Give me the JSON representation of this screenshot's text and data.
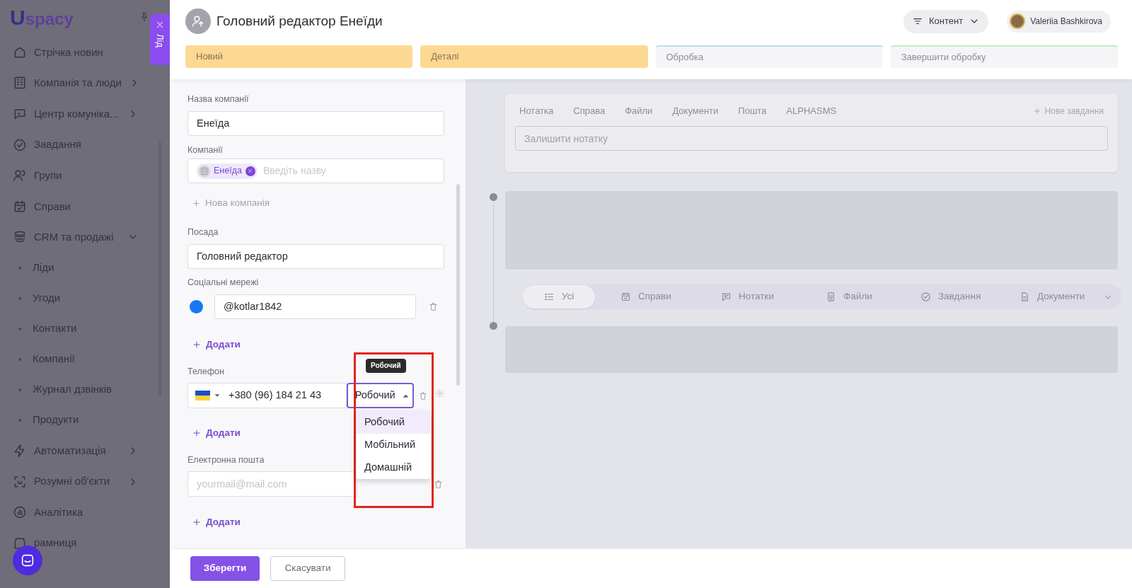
{
  "sidebar": {
    "logo": "Uspacy",
    "items": [
      {
        "label": "Стрічка новин",
        "expandable": false
      },
      {
        "label": "Компанія та люди",
        "expandable": true
      },
      {
        "label": "Центр комуніка...",
        "expandable": true
      },
      {
        "label": "Завдання",
        "expandable": false
      },
      {
        "label": "Групи",
        "expandable": false
      },
      {
        "label": "Справи",
        "expandable": false
      },
      {
        "label": "CRM та продажі",
        "expandable": true,
        "children": [
          {
            "label": "Ліди"
          },
          {
            "label": "Угоди"
          },
          {
            "label": "Контакти"
          },
          {
            "label": "Компанії"
          },
          {
            "label": "Журнал дзвінків"
          },
          {
            "label": "Продукти"
          }
        ]
      },
      {
        "label": "Автоматизація",
        "expandable": true
      },
      {
        "label": "Розумні об'єкти",
        "expandable": true
      },
      {
        "label": "Аналітика",
        "expandable": false
      },
      {
        "label": "рамниця",
        "expandable": false
      }
    ]
  },
  "drawer_tab": {
    "label": "Лід"
  },
  "header": {
    "title": "Головний редактор Енеїди",
    "content_button": "Контент",
    "user": "Valeriia Bashkirova"
  },
  "stages": [
    {
      "label": "Новий",
      "reached": true,
      "color": "#fdd893"
    },
    {
      "label": "Деталі",
      "reached": true,
      "color": "#fdd893"
    },
    {
      "label": "Обробка",
      "reached": false,
      "color": "#b9e1ee"
    },
    {
      "label": "Завершити обробку",
      "reached": false,
      "color": "#bdebc3"
    }
  ],
  "form": {
    "company_name": {
      "label": "Назва компанії",
      "value": "Енеїда"
    },
    "companies": {
      "label": "Компанії",
      "tags": [
        "Енеїда"
      ],
      "placeholder": "Введіть назву"
    },
    "new_company": "Нова компанія",
    "position": {
      "label": "Посада",
      "value": "Головний редактор"
    },
    "social": {
      "label": "Соціальні мережі",
      "value": "@kotlar1842",
      "add": "Додати"
    },
    "phone": {
      "label": "Телефон",
      "value": "+380 (96) 184 21 43",
      "type": "Робочий",
      "open": true,
      "tooltip": "Робочий",
      "options": [
        {
          "label": "Робочий",
          "selected": true
        },
        {
          "label": "Мобільний",
          "selected": false
        },
        {
          "label": "Домашній",
          "selected": false
        }
      ],
      "add": "Додати"
    },
    "email": {
      "label": "Електронна пошта",
      "placeholder": "yourmail@mail.com",
      "add": "Додати"
    }
  },
  "footer": {
    "buttons": [
      {
        "label": "Зберегти",
        "kind": "primary"
      },
      {
        "label": "Скасувати",
        "kind": "secondary"
      }
    ]
  },
  "feed": {
    "tabs": [
      "Нотатка",
      "Справа",
      "Файли",
      "Документи",
      "Пошта",
      "ALPHASMS"
    ],
    "new_task": "Нове завдання",
    "placeholder": "Залишити нотатку",
    "filters": [
      {
        "label": "Усі",
        "selected": true
      },
      {
        "label": "Справи",
        "selected": false
      },
      {
        "label": "Нотатки",
        "selected": false
      },
      {
        "label": "Файли",
        "selected": false
      },
      {
        "label": "Завдання",
        "selected": false
      },
      {
        "label": "Документи",
        "selected": false
      }
    ]
  }
}
